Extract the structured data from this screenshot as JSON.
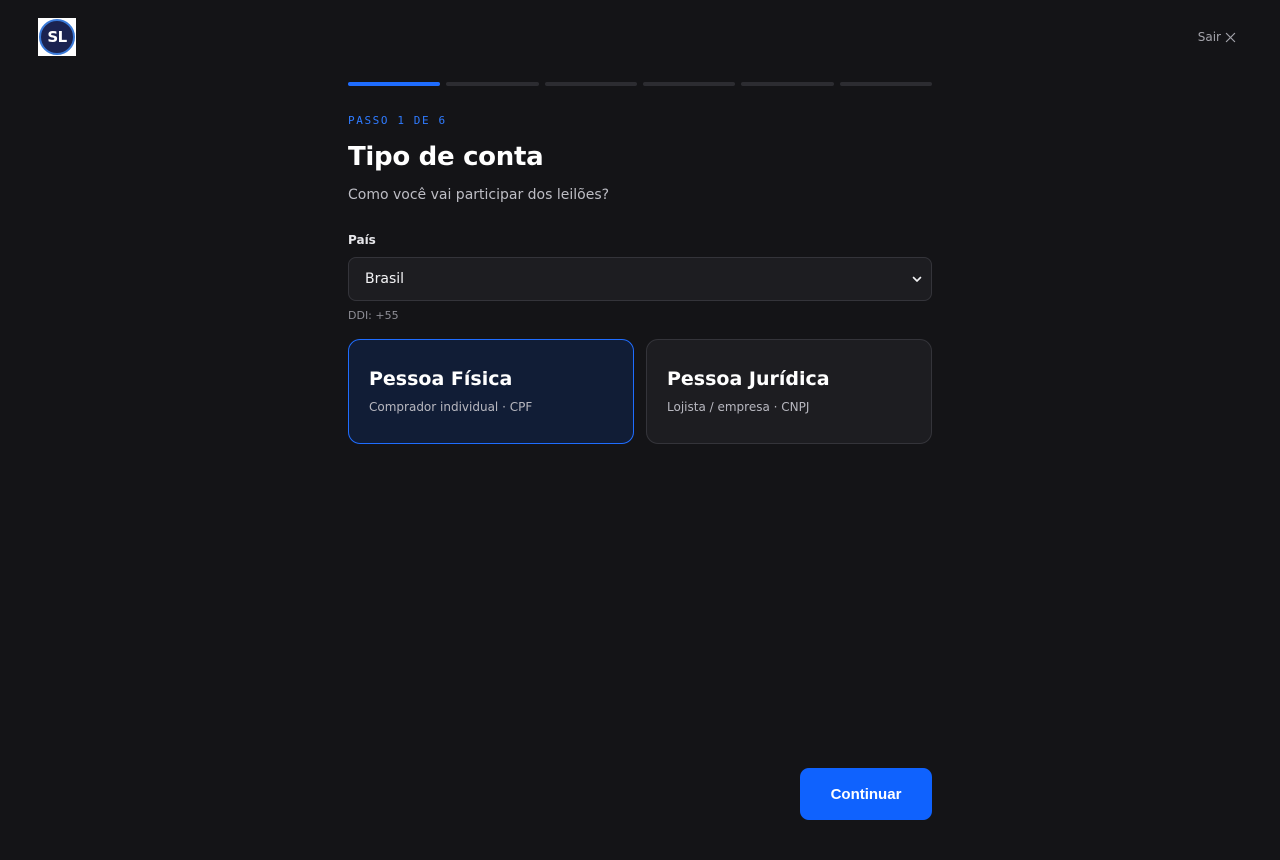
{
  "header": {
    "logo_text": "SL",
    "exit_label": "Sair"
  },
  "progress": {
    "current_step": 1,
    "total_steps": 6
  },
  "step_label": "PASSO 1 DE 6",
  "title": "Tipo de conta",
  "subtitle": "Como você vai participar dos leilões?",
  "country": {
    "label": "País",
    "selected": "Brasil",
    "hint": "DDI: +55"
  },
  "account_types": [
    {
      "title": "Pessoa Física",
      "description": "Comprador individual · CPF",
      "selected": true
    },
    {
      "title": "Pessoa Jurídica",
      "description": "Lojista / empresa · CNPJ",
      "selected": false
    }
  ],
  "continue_label": "Continuar",
  "colors": {
    "background": "#141417",
    "accent": "#0f62fe",
    "selected_card_bg": "#111d36"
  }
}
